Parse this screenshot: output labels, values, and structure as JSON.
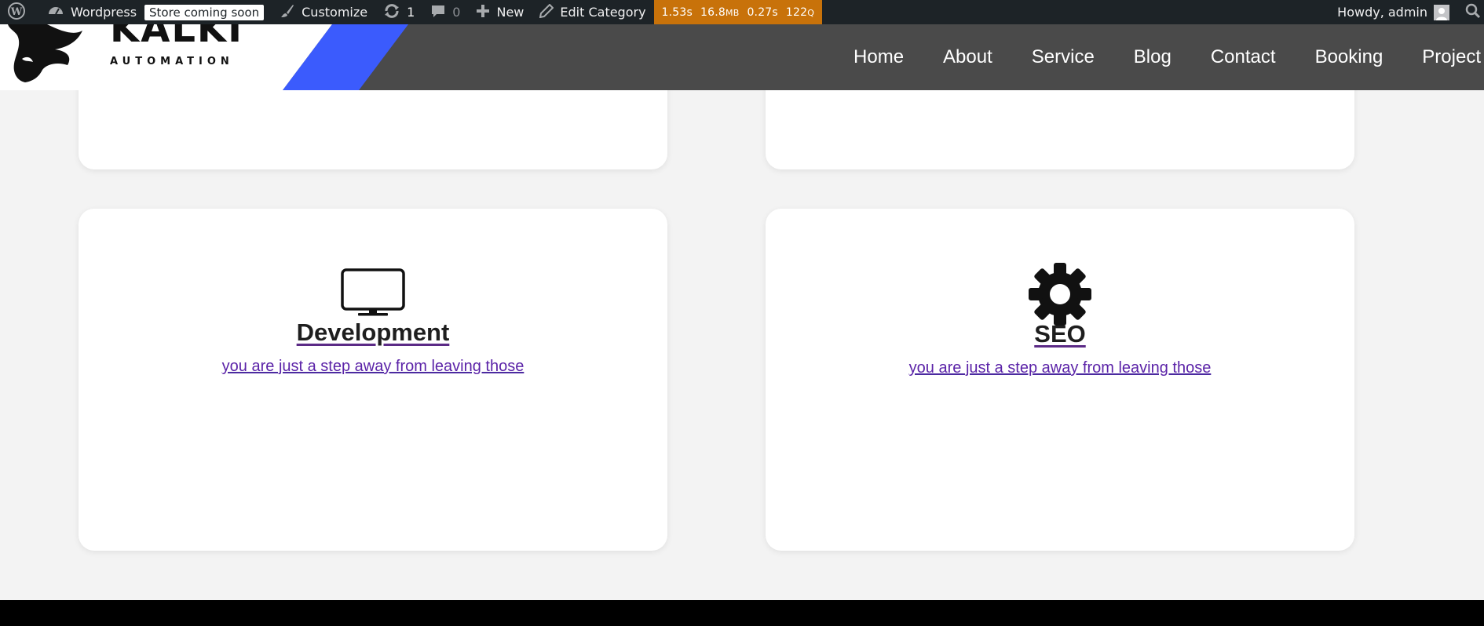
{
  "adminbar": {
    "site_name": "Wordpress",
    "store_badge": "Store coming soon",
    "customize": "Customize",
    "updates_count": "1",
    "comments_count": "0",
    "new_label": "New",
    "edit_label": "Edit Category",
    "query_monitor": {
      "time": "1.53s",
      "memory_value": "16.8",
      "memory_unit": "MB",
      "db_time": "0.27s",
      "queries_value": "122",
      "queries_unit": "Q"
    },
    "howdy": "Howdy, admin",
    "colors": {
      "bar": "#1d2327",
      "query_monitor": "#c8720a"
    }
  },
  "header": {
    "brand_name": "KALKI",
    "brand_sub": "AUTOMATION",
    "nav": [
      {
        "label": "Home"
      },
      {
        "label": "About"
      },
      {
        "label": "Service"
      },
      {
        "label": "Blog"
      },
      {
        "label": "Contact"
      },
      {
        "label": "Booking"
      },
      {
        "label": "Project"
      }
    ],
    "colors": {
      "bar": "#4a4a4a",
      "accent": "#3b5bfd"
    }
  },
  "cards": [
    {
      "title": "Development",
      "description": "you are just a step away from leaving those",
      "icon": "monitor-icon"
    },
    {
      "title": "SEO",
      "description": "you are just a step away from leaving those",
      "icon": "gear-icon"
    }
  ]
}
